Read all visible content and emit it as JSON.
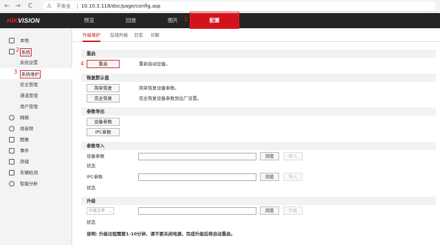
{
  "browser": {
    "back": "←",
    "forward": "→",
    "reload": "C",
    "security_icon": "warning-triangle-icon",
    "security_text": "不安全",
    "url": "10.10.3.118/doc/page/config.asp"
  },
  "topnav": {
    "logo_red": "HIK",
    "logo_white": "VISION",
    "items": [
      "预览",
      "回放",
      "图片",
      "配置"
    ],
    "active_index": 3,
    "marker": "1"
  },
  "sidebar": {
    "items": [
      {
        "label": "本地",
        "icon": "monitor-icon"
      },
      {
        "label": "系统",
        "icon": "system-icon",
        "marker": "2"
      },
      {
        "label": "系统设置"
      },
      {
        "label": "系统维护",
        "marker": "3"
      },
      {
        "label": "安全管理"
      },
      {
        "label": "通道管理"
      },
      {
        "label": "用户管理"
      },
      {
        "label": "网络",
        "icon": "network-icon"
      },
      {
        "label": "视音频",
        "icon": "video-audio-icon"
      },
      {
        "label": "图像",
        "icon": "image-icon"
      },
      {
        "label": "事件",
        "icon": "event-icon"
      },
      {
        "label": "存储",
        "icon": "storage-icon"
      },
      {
        "label": "车辆检测",
        "icon": "vehicle-icon"
      },
      {
        "label": "智能分析",
        "icon": "analysis-icon"
      }
    ]
  },
  "tabs": [
    "升级维护",
    "在线升级",
    "日志",
    "诊断"
  ],
  "sections": {
    "reboot": {
      "title": "重启",
      "button": "重启",
      "desc": "重新启动设备。",
      "marker": "4"
    },
    "restore": {
      "title": "恢复默认值",
      "simple_button": "简单恢复",
      "simple_desc": "简单恢复设备参数。",
      "full_button": "完全恢复",
      "full_desc": "完全恢复设备参数到出厂设置。"
    },
    "export": {
      "title": "参数导出",
      "device_button": "设备参数",
      "ipc_button": "IPC参数"
    },
    "import": {
      "title": "参数导入",
      "device_label": "设备参数",
      "ipc_label": "IPC参数",
      "status_label": "状态",
      "browse": "浏览",
      "import": "导入"
    },
    "upgrade": {
      "title": "升级",
      "select_value": "升级文件",
      "status_label": "状态",
      "browse": "浏览",
      "upgrade": "升级"
    }
  },
  "note": "说明: 升级过程需要1-10分钟，请不要关闭电源，完成升级后将自动重启。"
}
